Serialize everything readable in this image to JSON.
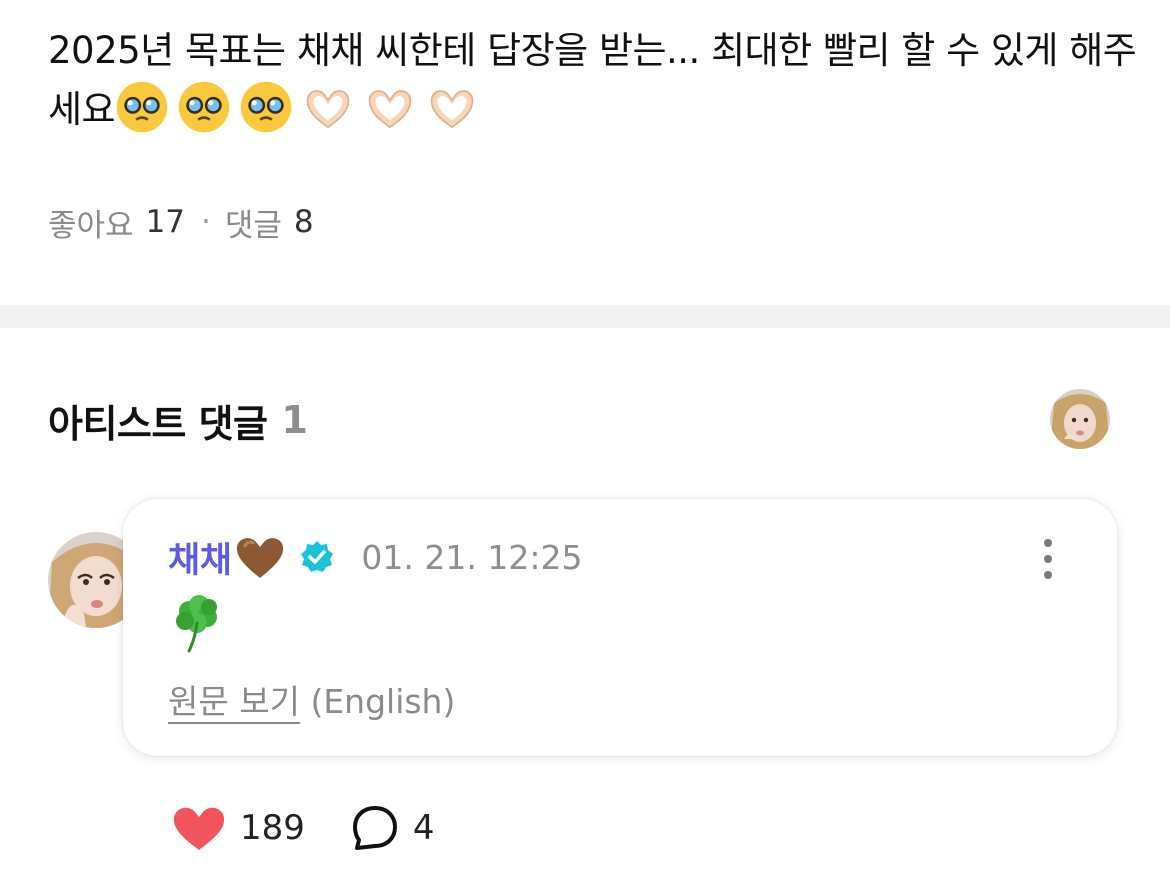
{
  "post": {
    "text": "2025년 목표는 채채 씨한테 답장을 받는... 최대한 빨리 할 수 있게 해주세요",
    "emojis": [
      "pleading-face",
      "pleading-face",
      "pleading-face",
      "heart-hands",
      "heart-hands",
      "heart-hands"
    ],
    "likes_label": "좋아요",
    "likes_count": "17",
    "separator": "·",
    "comments_label": "댓글",
    "comments_count": "8"
  },
  "artist_comments": {
    "title": "아티스트 댓글",
    "count": "1"
  },
  "comment": {
    "author": "채채",
    "author_emoji": "brown-heart",
    "verified_icon": "verified-badge-icon",
    "time": "01. 21. 12:25",
    "body_emoji": "four-leaf-clover",
    "translate_link": "원문 보기",
    "translate_lang": "(English)",
    "like_count": "189",
    "reply_count": "4"
  },
  "colors": {
    "author": "#5b5ce6",
    "verified": "#19c4d8",
    "like_heart": "#f2545b",
    "divider": "#f2f2f2"
  }
}
